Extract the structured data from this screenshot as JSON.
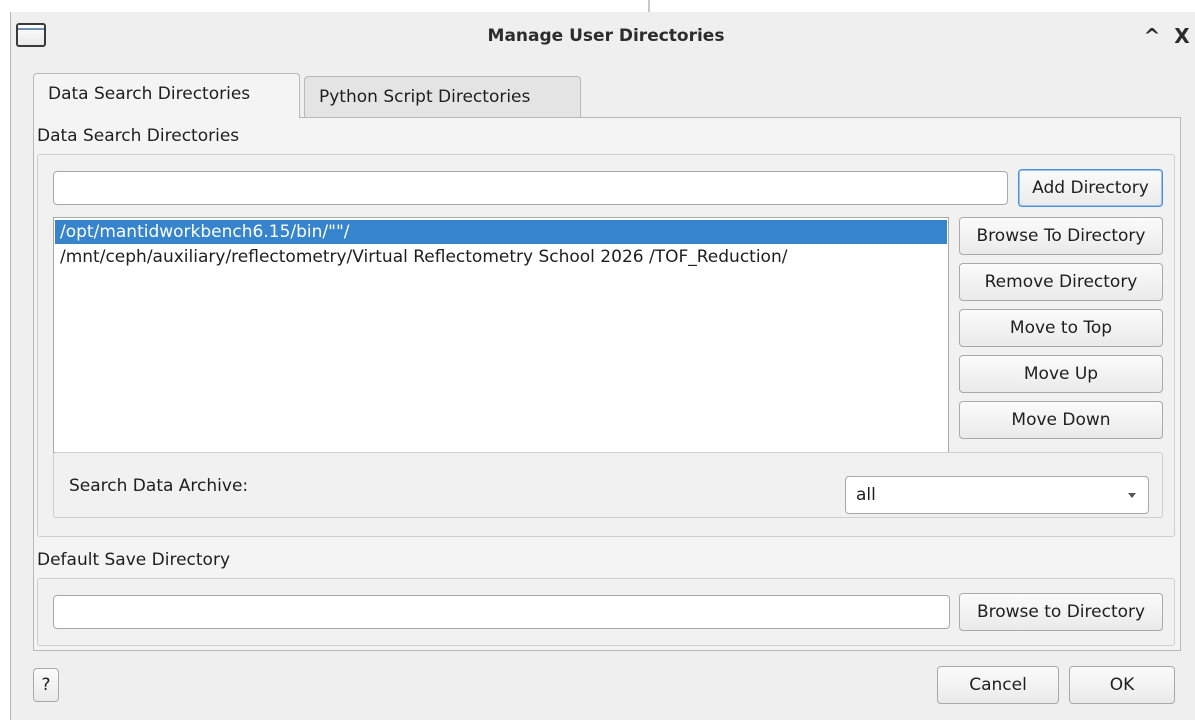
{
  "window": {
    "title": "Manage User Directories",
    "collapse_glyph": "^",
    "close_glyph": "X"
  },
  "tabs": [
    {
      "label": "Data Search Directories",
      "active": true
    },
    {
      "label": "Python Script Directories",
      "active": false
    }
  ],
  "data_search": {
    "section_label": "Data Search Directories",
    "new_directory_value": "",
    "add_label": "Add Directory",
    "directories": [
      {
        "path": "/opt/mantidworkbench6.15/bin/\"\"/",
        "selected": true
      },
      {
        "path": "/mnt/ceph/auxiliary/reflectometry/Virtual Reflectometry School 2026 /TOF_Reduction/",
        "selected": false
      }
    ],
    "buttons": {
      "browse": "Browse To Directory",
      "remove": "Remove Directory",
      "move_top": "Move to Top",
      "move_up": "Move Up",
      "move_down": "Move Down"
    },
    "archive": {
      "label": "Search Data Archive:",
      "selected": "all"
    }
  },
  "default_save": {
    "section_label": "Default Save Directory",
    "value": "",
    "browse_label": "Browse to Directory"
  },
  "footer": {
    "help_label": "?",
    "cancel_label": "Cancel",
    "ok_label": "OK"
  },
  "colors": {
    "selection": "#3584cc",
    "focus_border": "#4a90d9",
    "dialog_bg": "#efefef"
  },
  "icons": {
    "window_icon": "window-icon",
    "collapse": "chevron-up-icon",
    "close": "close-icon",
    "combo_arrow": "chevron-down-icon"
  }
}
